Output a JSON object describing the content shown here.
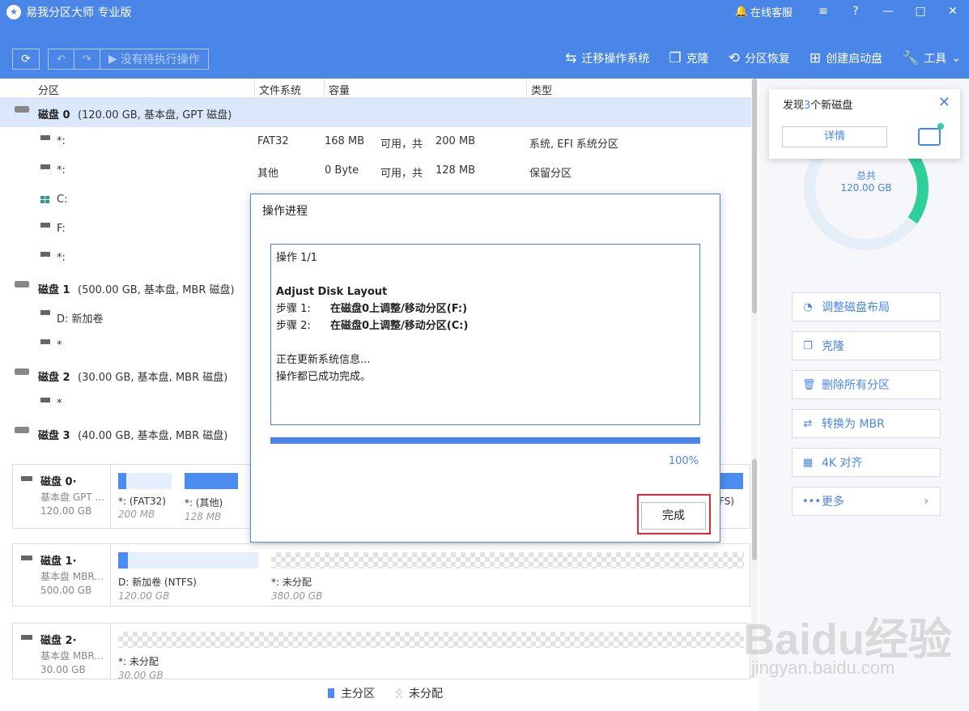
{
  "app": {
    "title": "易我分区大师 专业版",
    "service": "在线客服",
    "win": {
      "menu": "≡",
      "help": "?",
      "min": "—",
      "max": "□",
      "close": "✕"
    }
  },
  "toolbar": {
    "pending": "没有待执行操作",
    "actions": [
      {
        "label": "迁移操作系统",
        "icon": "migrate-icon"
      },
      {
        "label": "克隆",
        "icon": "clone-icon"
      },
      {
        "label": "分区恢复",
        "icon": "recovery-icon"
      },
      {
        "label": "创建启动盘",
        "icon": "windows-icon"
      },
      {
        "label": "工具",
        "icon": "wrench-icon"
      }
    ]
  },
  "list": {
    "headers": [
      "分区",
      "文件系统",
      "容量",
      "类型"
    ],
    "rows": [
      {
        "kind": "disk",
        "name": "磁盘 0",
        "detail": "(120.00 GB, 基本盘, GPT 磁盘)",
        "selected": true
      },
      {
        "kind": "part",
        "name": "*:",
        "fs": "FAT32",
        "used": "168 MB",
        "mid": "可用，共",
        "total": "200 MB",
        "type": "系统, EFI 系统分区"
      },
      {
        "kind": "part",
        "name": "*:",
        "fs": "其他",
        "used": "0 Byte",
        "mid": "可用，共",
        "total": "128 MB",
        "type": "保留分区"
      },
      {
        "kind": "part",
        "name": "C:",
        "win": true
      },
      {
        "kind": "part",
        "name": "F:"
      },
      {
        "kind": "part",
        "name": "*:"
      },
      {
        "kind": "disk",
        "name": "磁盘 1",
        "detail": "(500.00 GB, 基本盘, MBR 磁盘)"
      },
      {
        "kind": "part",
        "name": "D: 新加卷"
      },
      {
        "kind": "part",
        "name": "*"
      },
      {
        "kind": "disk",
        "name": "磁盘 2",
        "detail": "(30.00 GB, 基本盘, MBR 磁盘)"
      },
      {
        "kind": "part",
        "name": "*"
      },
      {
        "kind": "disk",
        "name": "磁盘 3",
        "detail": "(40.00 GB, 基本盘, MBR 磁盘)"
      }
    ]
  },
  "maps": [
    {
      "name": "磁盘 0·",
      "type": "基本盘 GPT ...",
      "size": "120.00 GB",
      "segs": [
        {
          "label": "*:  (FAT32)",
          "size": "200 MB",
          "fill": 0.15
        },
        {
          "label": "*:  (其他)",
          "size": "128 MB",
          "fill": 1.0
        }
      ],
      "tail": "FS)"
    },
    {
      "name": "磁盘 1·",
      "type": "基本盘 MBR...",
      "size": "500.00 GB",
      "segs": [
        {
          "label": "D: 新加卷 (NTFS)",
          "size": "120.00 GB",
          "fill": 0.07
        },
        {
          "label": "*: 未分配",
          "size": "380.00 GB",
          "unalloc": true
        }
      ]
    },
    {
      "name": "磁盘 2·",
      "type": "基本盘 MBR...",
      "size": "30.00 GB",
      "segs": [
        {
          "label": "*: 未分配",
          "size": "30.00 GB",
          "unalloc": true
        }
      ]
    }
  ],
  "legend": {
    "primary": "主分区",
    "unalloc": "未分配",
    "primary_color": "#4a8cf0"
  },
  "notice": {
    "prefix": "发现",
    "count": "3",
    "suffix": "个新磁盘",
    "details": "详情"
  },
  "donut": {
    "label": "总共",
    "value": "120.00 GB"
  },
  "right_actions": [
    {
      "label": "调整磁盘布局",
      "icon": "layout-icon",
      "glyph": "◔"
    },
    {
      "label": "克隆",
      "icon": "clone-icon",
      "glyph": "❐"
    },
    {
      "label": "删除所有分区",
      "icon": "trash-icon",
      "glyph": "🗑"
    },
    {
      "label": "转换为 MBR",
      "icon": "convert-icon",
      "glyph": "⇄"
    },
    {
      "label": "4K 对齐",
      "icon": "align-4k-icon",
      "glyph": "▦"
    },
    {
      "label": "更多",
      "icon": "more-icon",
      "glyph": "•••",
      "chevron": "›"
    }
  ],
  "dialog": {
    "title": "操作进程",
    "op": "操作 1/1",
    "heading": "Adjust Disk Layout",
    "steps": [
      {
        "k": "步骤 1:",
        "v": "在磁盘0上调整/移动分区(F:)"
      },
      {
        "k": "步骤 2:",
        "v": "在磁盘0上调整/移动分区(C:)"
      }
    ],
    "msg1": "正在更新系统信息...",
    "msg2": "操作都已成功完成。",
    "progress": 1.0,
    "percent": "100%",
    "done": "完成"
  },
  "watermark": {
    "main": "Baidu经验",
    "sub": "jingyan.baidu.com"
  }
}
